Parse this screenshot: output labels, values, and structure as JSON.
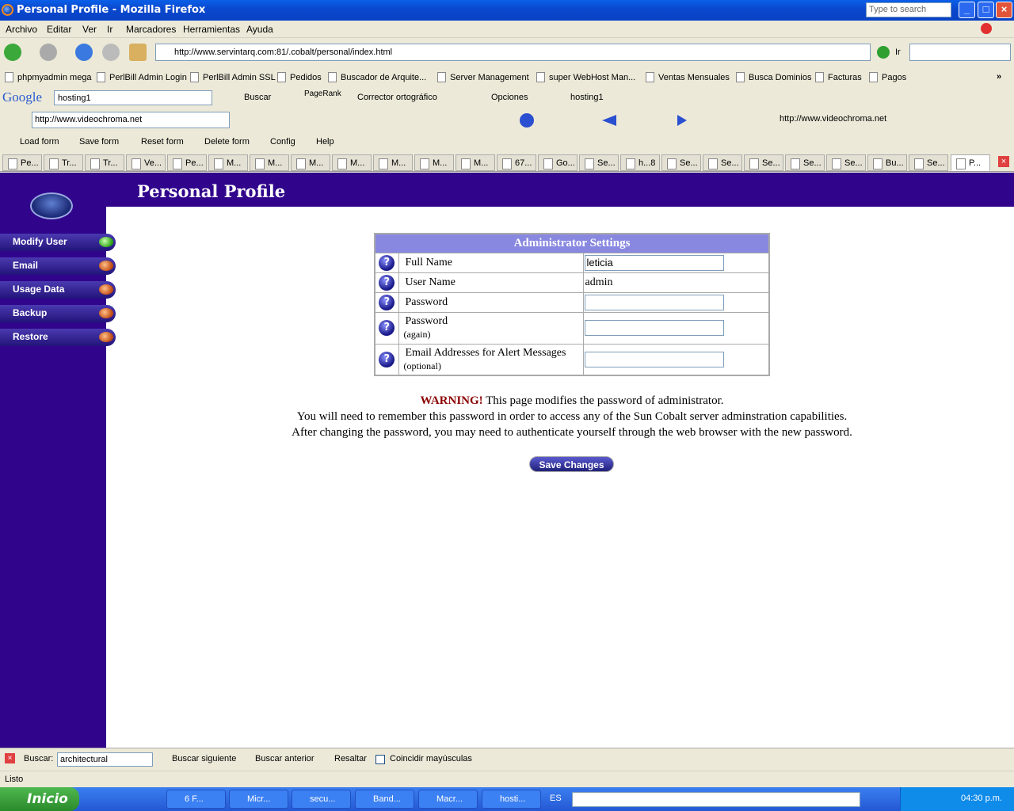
{
  "window": {
    "title": "Personal Profile - Mozilla Firefox",
    "search_placeholder": "Type to search"
  },
  "menubar": [
    "Archivo",
    "Editar",
    "Ver",
    "Ir",
    "Marcadores",
    "Herramientas",
    "Ayuda"
  ],
  "nav": {
    "url": "http://www.servintarq.com:81/.cobalt/personal/index.html",
    "go": "Ir"
  },
  "bookmarks": [
    "phpmyadmin mega",
    "PerlBill Admin Login",
    "PerlBill Admin SSL",
    "Pedidos",
    "Buscador de Arquite...",
    "Server Management",
    "super WebHost Man...",
    "Ventas Mensuales",
    "Busca Dominios",
    "Facturas",
    "Pagos"
  ],
  "google_toolbar": {
    "logo": "Google",
    "query": "hosting1",
    "search": "Buscar",
    "pagerank": "PageRank",
    "spell": "Corrector ortográfico",
    "options": "Opciones",
    "highlight": "hosting1"
  },
  "toolbar2": {
    "url": "http://www.videochroma.net",
    "link": "http://www.videochroma.net"
  },
  "toolbar3": [
    "Load form",
    "Save form",
    "Reset form",
    "Delete form",
    "Config",
    "Help"
  ],
  "tabs": [
    "Pe...",
    "Tr...",
    "Tr...",
    "Ve...",
    "Pe...",
    "M...",
    "M...",
    "M...",
    "M...",
    "M...",
    "M...",
    "M...",
    "67...",
    "Go...",
    "Se...",
    "h...8",
    "Se...",
    "Se...",
    "Se...",
    "Se...",
    "Se...",
    "Bu...",
    "Se...",
    "P..."
  ],
  "page": {
    "title": "Personal Profile",
    "sidebar": [
      {
        "label": "Modify User",
        "active": true
      },
      {
        "label": "Email"
      },
      {
        "label": "Usage Data"
      },
      {
        "label": "Backup"
      },
      {
        "label": "Restore"
      }
    ],
    "table_header": "Administrator Settings",
    "rows": {
      "full_name": {
        "label": "Full Name",
        "value": "leticia"
      },
      "user_name": {
        "label": "User Name",
        "value": "admin"
      },
      "password": {
        "label": "Password"
      },
      "password_again": {
        "label": "Password",
        "sub": "(again)"
      },
      "email": {
        "label": "Email Addresses for Alert Messages",
        "sub": "(optional)"
      }
    },
    "warning": {
      "strong": "WARNING!",
      "line1": " This page modifies the password of administrator.",
      "line2": "You will need to remember this password in order to access any of the Sun Cobalt server adminstration capabilities.",
      "line3": "After changing the password, you may need to authenticate yourself through the web browser with the new password."
    },
    "save_label": "Save Changes"
  },
  "findbar": {
    "label": "Buscar:",
    "value": "architectural",
    "next": "Buscar siguiente",
    "prev": "Buscar anterior",
    "highlight": "Resaltar",
    "match_case": "Coincidir mayúsculas"
  },
  "status": "Listo",
  "taskbar": {
    "start": "Inicio",
    "tasks": [
      "6 F...",
      "Micr...",
      "secu...",
      "Band...",
      "Macr...",
      "hosti..."
    ],
    "lang": "ES",
    "clock": "04:30 p.m."
  }
}
